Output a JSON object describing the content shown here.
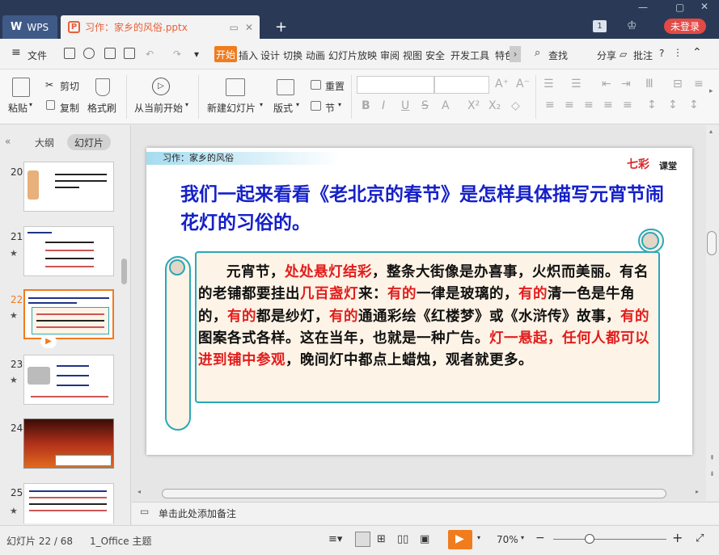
{
  "window": {
    "app_tab": "WPS",
    "doc_tab": "习作：家乡的风俗.pptx",
    "badge": "1",
    "login": "未登录"
  },
  "menu": {
    "file": "文件",
    "tabs": [
      "开始",
      "插入",
      "设计",
      "切换",
      "动画",
      "幻灯片放映",
      "审阅",
      "视图",
      "安全",
      "开发工具",
      "特色"
    ],
    "find": "查找",
    "share": "分享",
    "comment": "批注"
  },
  "ribbon": {
    "paste": "粘贴",
    "cut": "剪切",
    "copy": "复制",
    "format_painter": "格式刷",
    "play_from_current": "从当前开始",
    "new_slide": "新建幻灯片",
    "layout": "版式",
    "section": "节",
    "reset": "重置"
  },
  "left_panel": {
    "tab_outline": "大纲",
    "tab_slides": "幻灯片",
    "thumbnails": [
      {
        "num": "20"
      },
      {
        "num": "21"
      },
      {
        "num": "22"
      },
      {
        "num": "23"
      },
      {
        "num": "24"
      },
      {
        "num": "25"
      }
    ]
  },
  "slide": {
    "header": "习作：家乡的风俗",
    "logo_a": "七彩",
    "logo_b": "课堂",
    "heading": "我们一起来看看《老北京的春节》是怎样具体描写元宵节闹花灯的习俗的。",
    "passage": [
      {
        "t": "元宵节，",
        "red": false
      },
      {
        "t": "处处悬灯结彩",
        "red": true
      },
      {
        "t": "，整条大街像是办喜事，火炽而美丽。有名的老铺都要挂出",
        "red": false
      },
      {
        "t": "几百盏灯",
        "red": true
      },
      {
        "t": "来：",
        "red": false
      },
      {
        "t": "有的",
        "red": true
      },
      {
        "t": "一律是玻璃的，",
        "red": false
      },
      {
        "t": "有的",
        "red": true
      },
      {
        "t": "清一色是牛角的，",
        "red": false
      },
      {
        "t": "有的",
        "red": true
      },
      {
        "t": "都是纱灯，",
        "red": false
      },
      {
        "t": "有的",
        "red": true
      },
      {
        "t": "通通彩绘《红楼梦》或《水浒传》故事，",
        "red": false
      },
      {
        "t": "有的",
        "red": true
      },
      {
        "t": "图案各式各样。这在当年，也就是一种广告。",
        "red": false
      },
      {
        "t": "灯一悬起，任何人都可以进到铺中参观",
        "red": true
      },
      {
        "t": "，晚间灯中都点上蜡烛，观者就更多。",
        "red": false
      }
    ]
  },
  "notes": {
    "placeholder": "单击此处添加备注"
  },
  "status": {
    "slide_count": "幻灯片 22 / 68",
    "theme": "1_Office 主题",
    "zoom": "70%"
  }
}
